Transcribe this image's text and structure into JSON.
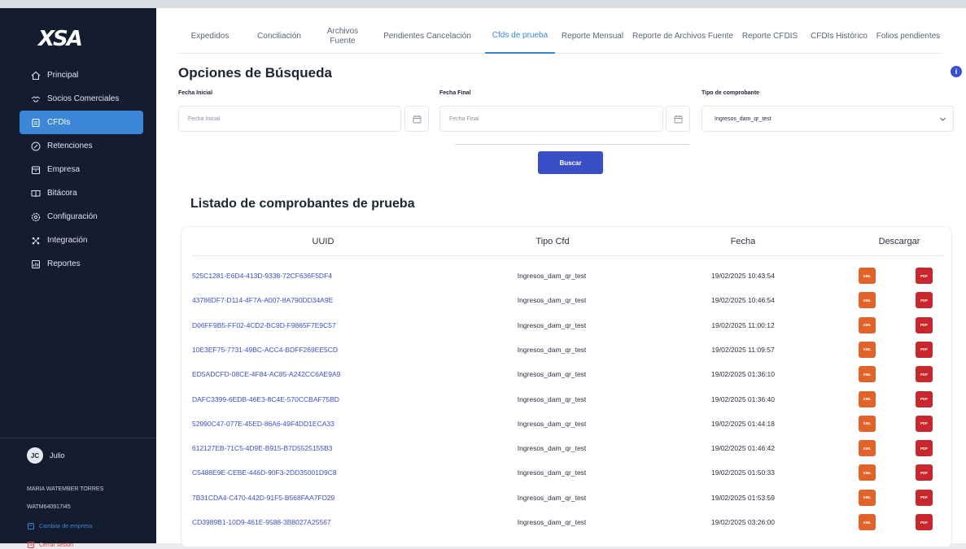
{
  "brand": {
    "logo": "XSA"
  },
  "sidebar": {
    "items": [
      {
        "label": "Principal",
        "icon": "home-icon"
      },
      {
        "label": "Socios Comerciales",
        "icon": "handshake-icon"
      },
      {
        "label": "CFDIs",
        "icon": "document-icon",
        "active": true
      },
      {
        "label": "Retenciones",
        "icon": "percent-icon"
      },
      {
        "label": "Empresa",
        "icon": "building-icon"
      },
      {
        "label": "Bitácora",
        "icon": "book-icon"
      },
      {
        "label": "Configuración",
        "icon": "gear-icon"
      },
      {
        "label": "Integración",
        "icon": "integration-icon"
      },
      {
        "label": "Reportes",
        "icon": "chart-icon"
      }
    ],
    "user": {
      "initials": "JC",
      "name": "Julio"
    },
    "company_name": "MARIA WATEMBER TORRES",
    "company_rfc": "WATM640917I45",
    "change_company": "Cambiar de empresa",
    "logout": "Cerrar sesión"
  },
  "tabs": [
    {
      "label": "Expedidos"
    },
    {
      "label": "Conciliación"
    },
    {
      "label": "Archivos Fuente"
    },
    {
      "label": "Pendientes Cancelación"
    },
    {
      "label": "Cfds de prueba",
      "active": true
    },
    {
      "label": "Reporte Mensual"
    },
    {
      "label": "Reporte de Archivos Fuente"
    },
    {
      "label": "Reporte CFDIS"
    },
    {
      "label": "CFDIs Histórico"
    },
    {
      "label": "Folios pendientes"
    }
  ],
  "search": {
    "title": "Opciones de Búsqueda",
    "fecha_inicial_label": "Fecha Inicial",
    "fecha_inicial_placeholder": "Fecha Inicial",
    "fecha_final_label": "Fecha Final",
    "fecha_final_placeholder": "Fecha Final",
    "tipo_label": "Tipo de comprobante",
    "tipo_value": "Ingresos_dam_qr_test",
    "button": "Buscar"
  },
  "list": {
    "title": "Listado de comprobantes de prueba",
    "columns": [
      "UUID",
      "Tipo Cfd",
      "Fecha",
      "Descargar"
    ],
    "xml_label": "XML",
    "pdf_label": "PDF",
    "rows": [
      {
        "uuid": "525C1281-E6D4-413D-9338-72CF636F5DF4",
        "tipo": "Ingresos_dam_qr_test",
        "fecha": "19/02/2025 10:43:54"
      },
      {
        "uuid": "43786DF7-D114-4F7A-A007-8A790DD34A9E",
        "tipo": "Ingresos_dam_qr_test",
        "fecha": "19/02/2025 10:46:54"
      },
      {
        "uuid": "D06FF9B5-FF02-4CD2-BC9D-F9865F7E9C57",
        "tipo": "Ingresos_dam_qr_test",
        "fecha": "19/02/2025 11:00:12"
      },
      {
        "uuid": "10E3EF75-7731-49BC-ACC4-BDFF269EE5CD",
        "tipo": "Ingresos_dam_qr_test",
        "fecha": "19/02/2025 11:09:57"
      },
      {
        "uuid": "ED5ADCFD-08CE-4F84-AC85-A242CC6AE9A9",
        "tipo": "Ingresos_dam_qr_test",
        "fecha": "19/02/2025 01:36:10"
      },
      {
        "uuid": "DAFC3399-6EDB-46E3-8C4E-570CCBAF75BD",
        "tipo": "Ingresos_dam_qr_test",
        "fecha": "19/02/2025 01:36:40"
      },
      {
        "uuid": "52990C47-077E-45ED-86A6-49F4DD1ECA33",
        "tipo": "Ingresos_dam_qr_test",
        "fecha": "19/02/2025 01:44:18"
      },
      {
        "uuid": "612127EB-71C5-4D9E-B915-B7D5525155B3",
        "tipo": "Ingresos_dam_qr_test",
        "fecha": "19/02/2025 01:46:42"
      },
      {
        "uuid": "C5488E9E-CEBE-446D-90F3-2DD35001D9C8",
        "tipo": "Ingresos_dam_qr_test",
        "fecha": "19/02/2025 01:50:33"
      },
      {
        "uuid": "7B31CDA4-C470-442D-91F5-B568FAA7FD29",
        "tipo": "Ingresos_dam_qr_test",
        "fecha": "19/02/2025 01:53:59"
      },
      {
        "uuid": "CD3989B1-10D9-461E-9588-3B8027A25567",
        "tipo": "Ingresos_dam_qr_test",
        "fecha": "19/02/2025 03:26:00"
      }
    ]
  }
}
